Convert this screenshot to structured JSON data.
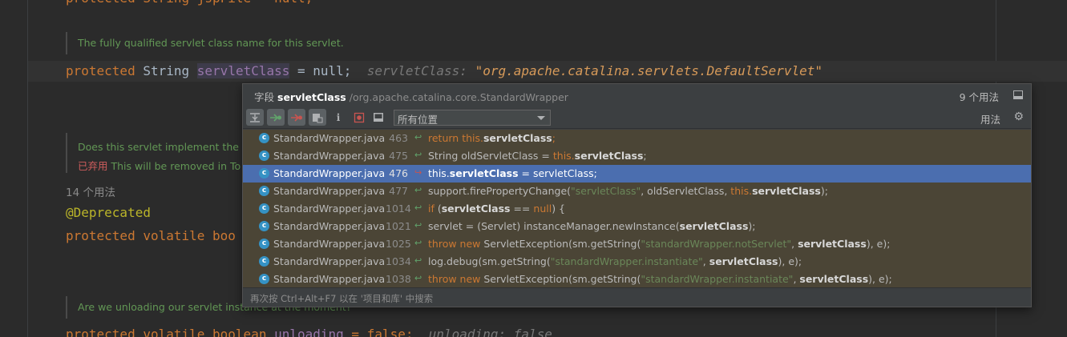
{
  "editor": {
    "doc1": "The fully qualified servlet class name for this servlet.",
    "line1": {
      "kw": "protected",
      "type": "String",
      "field": "servletClass",
      "rest": " = null;",
      "hint_name": "servletClass:",
      "hint_value": "\"org.apache.catalina.servlets.DefaultServlet\""
    },
    "doc2_line1": "Does this servlet implement the S",
    "doc2_deprecated": "已弃用",
    "doc2_line2": " This will be removed in To",
    "usage_count": "14 个用法",
    "annotation": "@Deprecated",
    "line2": "protected volatile boo",
    "doc3": "Are we unloading our servlet instance at the moment?",
    "line3": {
      "kw": "protected volatile boolean",
      "field": "unloading",
      "rest": " = false;",
      "hint": "unloading: false"
    }
  },
  "popup": {
    "title_prefix": "字段",
    "field_name": "servletClass",
    "package": "/org.apache.catalina.core.StandardWrapper",
    "count": "9 个用法",
    "scope": "所有位置",
    "usages_label": "用法",
    "footer": "再次按 Ctrl+Alt+F7 以在 '项目和库' 中搜索",
    "rows": [
      {
        "file": "StandardWrapper.java",
        "line": "463"
      },
      {
        "file": "StandardWrapper.java",
        "line": "475"
      },
      {
        "file": "StandardWrapper.java",
        "line": "476"
      },
      {
        "file": "StandardWrapper.java",
        "line": "477"
      },
      {
        "file": "StandardWrapper.java",
        "line": "1014"
      },
      {
        "file": "StandardWrapper.java",
        "line": "1021"
      },
      {
        "file": "StandardWrapper.java",
        "line": "1025"
      },
      {
        "file": "StandardWrapper.java",
        "line": "1034"
      },
      {
        "file": "StandardWrapper.java",
        "line": "1038"
      }
    ],
    "code": {
      "r0": {
        "a": "return this.",
        "b": "servletClass",
        "c": ";"
      },
      "r1": {
        "a": "String oldServletClass = ",
        "k": "this.",
        "b": "servletClass",
        "c": ";"
      },
      "r2": {
        "a": "this.",
        "b": "servletClass",
        "c": " = servletClass;"
      },
      "r3": {
        "a": "support.firePropertyChange(",
        "s": "\"servletClass\"",
        "m": ", oldServletClass, ",
        "k": "this.",
        "b": "servletClass",
        "c": ");"
      },
      "r4": {
        "k": "if",
        "a": " (",
        "b": "servletClass",
        "m": " == ",
        "k2": "null",
        "c": ") {"
      },
      "r5": {
        "a": "servlet = (Servlet) instanceManager.newInstance(",
        "b": "servletClass",
        "c": ");"
      },
      "r6": {
        "k": "throw new",
        "a": " ServletException(sm.getString(",
        "s": "\"standardWrapper.notServlet\"",
        "m": ", ",
        "b": "servletClass",
        "c": "), e);"
      },
      "r7": {
        "a": "log.debug(sm.getString(",
        "s": "\"standardWrapper.instantiate\"",
        "m": ", ",
        "b": "servletClass",
        "c": "), e);"
      },
      "r8": {
        "k": "throw new",
        "a": " ServletException(sm.getString(",
        "s": "\"standardWrapper.instantiate\"",
        "m": ", ",
        "b": "servletClass",
        "c": "), e);"
      }
    },
    "icons": [
      "expand-all-icon",
      "read-access-icon",
      "write-access-icon",
      "group-by-file-icon",
      "info-icon",
      "filter-icon",
      "preview-icon"
    ]
  }
}
